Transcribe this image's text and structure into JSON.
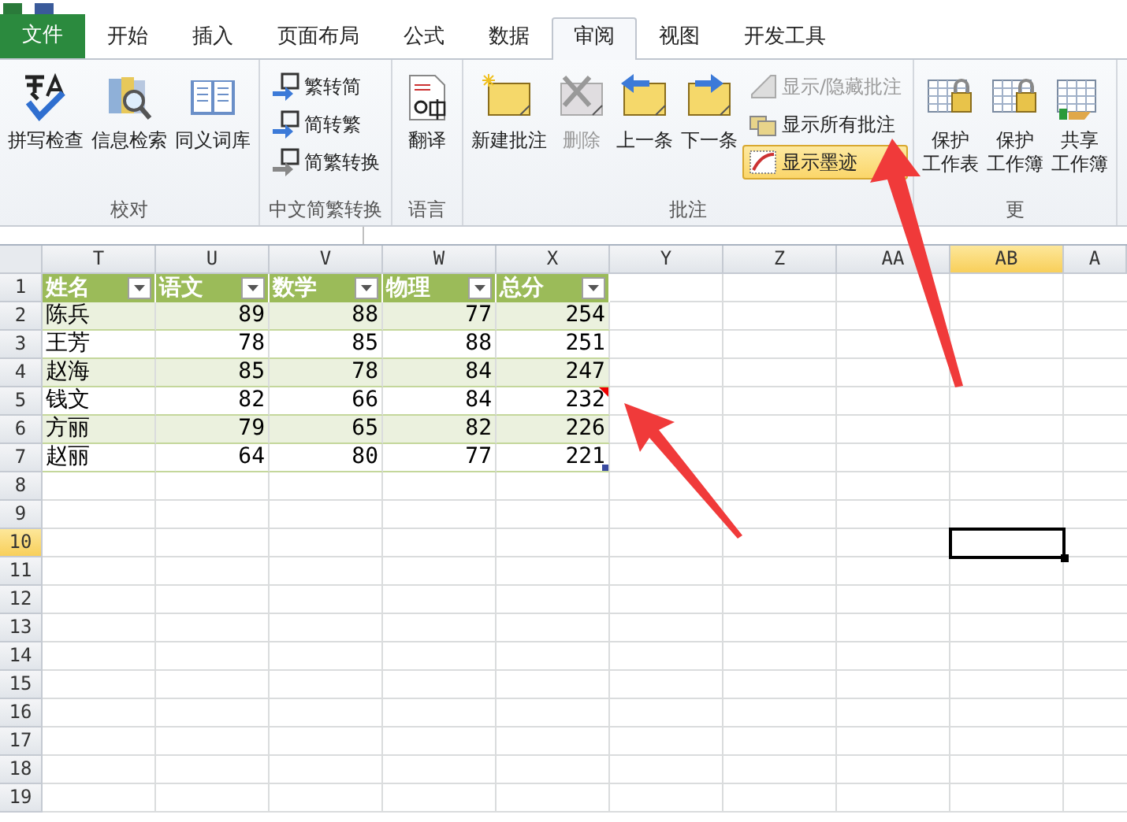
{
  "tabs": [
    {
      "label": "文件",
      "kind": "file",
      "selected": false
    },
    {
      "label": "开始",
      "kind": "tab",
      "selected": false
    },
    {
      "label": "插入",
      "kind": "tab",
      "selected": false
    },
    {
      "label": "页面布局",
      "kind": "tab",
      "selected": false
    },
    {
      "label": "公式",
      "kind": "tab",
      "selected": false
    },
    {
      "label": "数据",
      "kind": "tab",
      "selected": false
    },
    {
      "label": "审阅",
      "kind": "tab",
      "selected": true
    },
    {
      "label": "视图",
      "kind": "tab",
      "selected": false
    },
    {
      "label": "开发工具",
      "kind": "tab",
      "selected": false
    }
  ],
  "ribbon_groups": [
    {
      "label": "校对",
      "items": [
        {
          "kind": "large",
          "label_lines": [
            "拼写检查"
          ],
          "disabled": false
        },
        {
          "kind": "large",
          "label_lines": [
            "信息检索"
          ],
          "disabled": false
        },
        {
          "kind": "large",
          "label_lines": [
            "同义词库"
          ],
          "disabled": false
        }
      ]
    },
    {
      "label": "中文简繁转换",
      "items": [
        {
          "kind": "small",
          "label": "繁转简",
          "disabled": false,
          "on": false
        },
        {
          "kind": "small",
          "label": "简转繁",
          "disabled": false,
          "on": false
        },
        {
          "kind": "small",
          "label": "简繁转换",
          "disabled": false,
          "on": false
        }
      ]
    },
    {
      "label": "语言",
      "items": [
        {
          "kind": "large",
          "label_lines": [
            "翻译"
          ],
          "disabled": false
        }
      ]
    },
    {
      "label": "批注",
      "items": [
        {
          "kind": "large",
          "label_lines": [
            "新建批注"
          ],
          "disabled": false
        },
        {
          "kind": "large",
          "label_lines": [
            "删除"
          ],
          "disabled": true
        },
        {
          "kind": "large",
          "label_lines": [
            "上一条"
          ],
          "disabled": false
        },
        {
          "kind": "large",
          "label_lines": [
            "下一条"
          ],
          "disabled": false
        },
        {
          "kind": "small",
          "label": "显示/隐藏批注",
          "disabled": true,
          "on": false
        },
        {
          "kind": "small",
          "label": "显示所有批注",
          "disabled": false,
          "on": false
        },
        {
          "kind": "small",
          "label": "显示墨迹",
          "disabled": false,
          "on": true
        }
      ]
    },
    {
      "label": "更",
      "items": [
        {
          "kind": "large",
          "label_lines": [
            "保护",
            "工作表"
          ],
          "disabled": false
        },
        {
          "kind": "large",
          "label_lines": [
            "保护",
            "工作簿"
          ],
          "disabled": false
        },
        {
          "kind": "large",
          "label_lines": [
            "共享",
            "工作簿"
          ],
          "disabled": false
        }
      ]
    }
  ],
  "sheet": {
    "columns": [
      {
        "label": "T",
        "selected": false
      },
      {
        "label": "U",
        "selected": false
      },
      {
        "label": "V",
        "selected": false
      },
      {
        "label": "W",
        "selected": false
      },
      {
        "label": "X",
        "selected": false
      },
      {
        "label": "Y",
        "selected": false
      },
      {
        "label": "Z",
        "selected": false
      },
      {
        "label": "AA",
        "selected": false
      },
      {
        "label": "AB",
        "selected": true
      },
      {
        "label": "A",
        "selected": false
      }
    ],
    "row_numbers": [
      {
        "label": "1",
        "selected": false
      },
      {
        "label": "2",
        "selected": false
      },
      {
        "label": "3",
        "selected": false
      },
      {
        "label": "4",
        "selected": false
      },
      {
        "label": "5",
        "selected": false
      },
      {
        "label": "6",
        "selected": false
      },
      {
        "label": "7",
        "selected": false
      },
      {
        "label": "8",
        "selected": false
      },
      {
        "label": "9",
        "selected": false
      },
      {
        "label": "10",
        "selected": true
      },
      {
        "label": "11",
        "selected": false
      },
      {
        "label": "12",
        "selected": false
      },
      {
        "label": "13",
        "selected": false
      },
      {
        "label": "14",
        "selected": false
      },
      {
        "label": "15",
        "selected": false
      },
      {
        "label": "16",
        "selected": false
      },
      {
        "label": "17",
        "selected": false
      },
      {
        "label": "18",
        "selected": false
      },
      {
        "label": "19",
        "selected": false
      }
    ],
    "table": {
      "headers": [
        "姓名",
        "语文",
        "数学",
        "物理",
        "总分"
      ],
      "rows": [
        {
          "cells": [
            "陈兵",
            "89",
            "88",
            "77",
            "254"
          ],
          "comment": false
        },
        {
          "cells": [
            "王芳",
            "78",
            "85",
            "88",
            "251"
          ],
          "comment": false
        },
        {
          "cells": [
            "赵海",
            "85",
            "78",
            "84",
            "247"
          ],
          "comment": false
        },
        {
          "cells": [
            "钱文",
            "82",
            "66",
            "84",
            "232"
          ],
          "comment": true
        },
        {
          "cells": [
            "方丽",
            "79",
            "65",
            "82",
            "226"
          ],
          "comment": false
        },
        {
          "cells": [
            "赵丽",
            "64",
            "80",
            "77",
            "221"
          ],
          "comment": false
        }
      ]
    }
  }
}
